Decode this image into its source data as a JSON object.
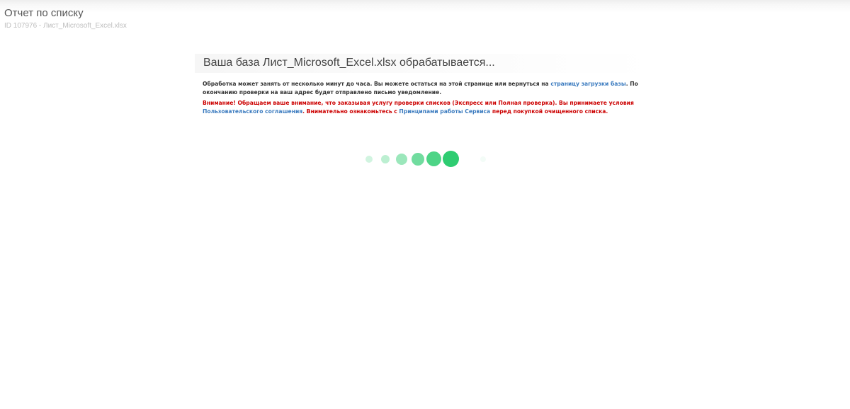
{
  "header": {
    "title": "Отчет по списку",
    "subtitle": "ID 107976 - Лист_Microsoft_Excel.xlsx"
  },
  "main": {
    "heading": "Ваша база Лист_Microsoft_Excel.xlsx обрабатывается...",
    "notice_before_link": "Обработка может занять от несколько минут до часа. Вы можете остаться на этой странице или вернуться на ",
    "notice_link": "страницу загрузки базы",
    "notice_after_link": ". По окончанию проверки на ваш адрес будет отправлено письмо уведомление.",
    "warning_part1": "Внимание! Обращаем ваше внимание, что заказывая услугу проверки списков (Экспресс или Полная проверка). Вы принимаете условия ",
    "warning_link1": "Пользовательского соглашения",
    "warning_part2": ". Внимательно ознакомьтесь с ",
    "warning_link2": "Принципами работы Сервиса",
    "warning_part3": " перед покупкой очищенного списка."
  },
  "colors": {
    "warning": "#cc0000",
    "link": "#3b7bbf",
    "loader_green": "#2ecc71"
  },
  "icons": {
    "loader": "loading-dots-icon"
  }
}
